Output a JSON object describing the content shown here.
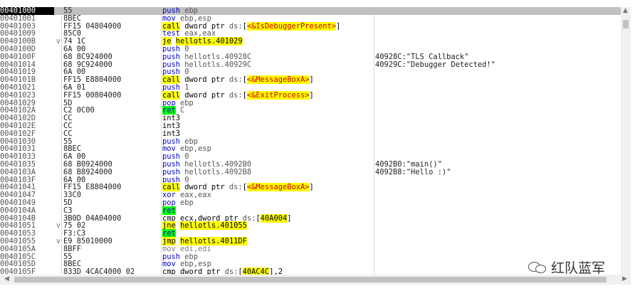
{
  "rows": [
    {
      "addr": "00401000",
      "bytes": "55",
      "mark": "",
      "i": [
        {
          "t": "push ",
          "c": "op"
        },
        {
          "t": "ebp",
          "c": "reg"
        }
      ],
      "cmt": "",
      "sel": true
    },
    {
      "addr": "00401001",
      "bytes": "8BEC",
      "mark": "",
      "i": [
        {
          "t": "mov ",
          "c": "op"
        },
        {
          "t": "ebp,esp",
          "c": "reg"
        }
      ],
      "cmt": ""
    },
    {
      "addr": "00401003",
      "bytes": "FF15 04804000",
      "mark": "",
      "i": [
        {
          "t": "call",
          "c": "hl-call"
        },
        {
          "t": " dword ptr ",
          "c": "ptr"
        },
        {
          "t": "ds:",
          "c": "reg"
        },
        {
          "t": "[",
          "c": "ptr"
        },
        {
          "t": "<&IsDebuggerPresent>",
          "c": "hl-api"
        },
        {
          "t": "]",
          "c": "ptr"
        }
      ],
      "cmt": ""
    },
    {
      "addr": "00401009",
      "bytes": "85C0",
      "mark": "",
      "i": [
        {
          "t": "test ",
          "c": "op"
        },
        {
          "t": "eax,eax",
          "c": "reg"
        }
      ],
      "cmt": ""
    },
    {
      "addr": "0040100B",
      "bytes": "74 1C",
      "mark": "v",
      "i": [
        {
          "t": "je",
          "c": "hl-op"
        },
        {
          "t": " ",
          "c": "ptr"
        },
        {
          "t": "hellotls.401029",
          "c": "hl-tgt"
        }
      ],
      "cmt": ""
    },
    {
      "addr": "0040100D",
      "bytes": "6A 00",
      "mark": "",
      "i": [
        {
          "t": "push ",
          "c": "op"
        },
        {
          "t": "0",
          "c": "imm"
        }
      ],
      "cmt": ""
    },
    {
      "addr": "0040100F",
      "bytes": "68 8C924000",
      "mark": "",
      "i": [
        {
          "t": "push ",
          "c": "op"
        },
        {
          "t": "hellotls.40928C",
          "c": "reg"
        }
      ],
      "cmt": "40928C:\"TLS Callback\""
    },
    {
      "addr": "00401014",
      "bytes": "68 9C924000",
      "mark": "",
      "i": [
        {
          "t": "push ",
          "c": "op"
        },
        {
          "t": "hellotls.40929C",
          "c": "reg"
        }
      ],
      "cmt": "40929C:\"Debugger Detected!\""
    },
    {
      "addr": "00401019",
      "bytes": "6A 00",
      "mark": "",
      "i": [
        {
          "t": "push ",
          "c": "op"
        },
        {
          "t": "0",
          "c": "imm"
        }
      ],
      "cmt": ""
    },
    {
      "addr": "0040101B",
      "bytes": "FF15 E8804000",
      "mark": "",
      "i": [
        {
          "t": "call",
          "c": "hl-call"
        },
        {
          "t": " dword ptr ",
          "c": "ptr"
        },
        {
          "t": "ds:",
          "c": "reg"
        },
        {
          "t": "[",
          "c": "ptr"
        },
        {
          "t": "<&MessageBoxA>",
          "c": "hl-api"
        },
        {
          "t": "]",
          "c": "ptr"
        }
      ],
      "cmt": ""
    },
    {
      "addr": "00401021",
      "bytes": "6A 01",
      "mark": "",
      "i": [
        {
          "t": "push ",
          "c": "op"
        },
        {
          "t": "1",
          "c": "imm"
        }
      ],
      "cmt": ""
    },
    {
      "addr": "00401023",
      "bytes": "FF15 00804000",
      "mark": "",
      "i": [
        {
          "t": "call",
          "c": "hl-call"
        },
        {
          "t": " dword ptr ",
          "c": "ptr"
        },
        {
          "t": "ds:",
          "c": "reg"
        },
        {
          "t": "[",
          "c": "ptr"
        },
        {
          "t": "<&ExitProcess>",
          "c": "hl-api"
        },
        {
          "t": "]",
          "c": "ptr"
        }
      ],
      "cmt": ""
    },
    {
      "addr": "00401029",
      "bytes": "5D",
      "mark": "",
      "i": [
        {
          "t": "pop ",
          "c": "op"
        },
        {
          "t": "ebp",
          "c": "reg"
        }
      ],
      "cmt": ""
    },
    {
      "addr": "0040102A",
      "bytes": "C2 0C00",
      "mark": "",
      "i": [
        {
          "t": "ret",
          "c": "ret-op"
        },
        {
          "t": " C",
          "c": "imm"
        }
      ],
      "cmt": ""
    },
    {
      "addr": "0040102D",
      "bytes": "CC",
      "mark": "",
      "i": [
        {
          "t": "int3",
          "c": "ptr"
        }
      ],
      "cmt": ""
    },
    {
      "addr": "0040102E",
      "bytes": "CC",
      "mark": "",
      "i": [
        {
          "t": "int3",
          "c": "ptr"
        }
      ],
      "cmt": ""
    },
    {
      "addr": "0040102F",
      "bytes": "CC",
      "mark": "",
      "i": [
        {
          "t": "int3",
          "c": "ptr"
        }
      ],
      "cmt": ""
    },
    {
      "addr": "00401030",
      "bytes": "55",
      "mark": "",
      "i": [
        {
          "t": "push ",
          "c": "op"
        },
        {
          "t": "ebp",
          "c": "reg"
        }
      ],
      "cmt": ""
    },
    {
      "addr": "00401031",
      "bytes": "8BEC",
      "mark": "",
      "i": [
        {
          "t": "mov ",
          "c": "op"
        },
        {
          "t": "ebp,esp",
          "c": "reg"
        }
      ],
      "cmt": ""
    },
    {
      "addr": "00401033",
      "bytes": "6A 00",
      "mark": "",
      "i": [
        {
          "t": "push ",
          "c": "op"
        },
        {
          "t": "0",
          "c": "imm"
        }
      ],
      "cmt": ""
    },
    {
      "addr": "00401035",
      "bytes": "68 B0924000",
      "mark": "",
      "i": [
        {
          "t": "push ",
          "c": "op"
        },
        {
          "t": "hellotls.4092B0",
          "c": "reg"
        }
      ],
      "cmt": "4092B0:\"main()\""
    },
    {
      "addr": "0040103A",
      "bytes": "68 B8924000",
      "mark": "",
      "i": [
        {
          "t": "push ",
          "c": "op"
        },
        {
          "t": "hellotls.4092B8",
          "c": "reg"
        }
      ],
      "cmt": "4092B8:\"Hello :)\""
    },
    {
      "addr": "0040103F",
      "bytes": "6A 00",
      "mark": "",
      "i": [
        {
          "t": "push ",
          "c": "op"
        },
        {
          "t": "0",
          "c": "imm"
        }
      ],
      "cmt": ""
    },
    {
      "addr": "00401041",
      "bytes": "FF15 E8804000",
      "mark": "",
      "i": [
        {
          "t": "call",
          "c": "hl-call"
        },
        {
          "t": " dword ptr ",
          "c": "ptr"
        },
        {
          "t": "ds:",
          "c": "reg"
        },
        {
          "t": "[",
          "c": "ptr"
        },
        {
          "t": "<&MessageBoxA>",
          "c": "hl-api"
        },
        {
          "t": "]",
          "c": "ptr"
        }
      ],
      "cmt": ""
    },
    {
      "addr": "00401047",
      "bytes": "33C0",
      "mark": "",
      "i": [
        {
          "t": "xor ",
          "c": "op"
        },
        {
          "t": "eax,eax",
          "c": "reg"
        }
      ],
      "cmt": ""
    },
    {
      "addr": "00401049",
      "bytes": "5D",
      "mark": "",
      "i": [
        {
          "t": "pop ",
          "c": "op"
        },
        {
          "t": "ebp",
          "c": "reg"
        }
      ],
      "cmt": ""
    },
    {
      "addr": "0040104A",
      "bytes": "C3",
      "mark": "",
      "i": [
        {
          "t": "ret",
          "c": "ret-op"
        }
      ],
      "cmt": ""
    },
    {
      "addr": "0040104B",
      "bytes": "3B0D 04A04000",
      "mark": "",
      "i": [
        {
          "t": "cmp ",
          "c": "ptr"
        },
        {
          "t": "ecx,dword ptr ",
          "c": "ptr"
        },
        {
          "t": "ds:",
          "c": "reg"
        },
        {
          "t": "[",
          "c": "ptr"
        },
        {
          "t": "40A004",
          "c": "hl-tgt"
        },
        {
          "t": "]",
          "c": "ptr"
        }
      ],
      "cmt": ""
    },
    {
      "addr": "00401051",
      "bytes": "75 02",
      "mark": "v",
      "i": [
        {
          "t": "jne",
          "c": "hl-op"
        },
        {
          "t": " ",
          "c": "ptr"
        },
        {
          "t": "hellotls.401055",
          "c": "hl-tgt"
        }
      ],
      "cmt": ""
    },
    {
      "addr": "00401053",
      "bytes": "F3:C3",
      "mark": "",
      "i": [
        {
          "t": "ret",
          "c": "ret-op"
        }
      ],
      "cmt": ""
    },
    {
      "addr": "00401055",
      "bytes": "E9 85010000",
      "mark": "v",
      "i": [
        {
          "t": "jmp",
          "c": "hl-op"
        },
        {
          "t": " ",
          "c": "ptr"
        },
        {
          "t": "hellotls.4011DF",
          "c": "hl-tgt"
        }
      ],
      "cmt": ""
    },
    {
      "addr": "0040105A",
      "bytes": "8BFF",
      "mark": "",
      "i": [
        {
          "t": "mov edi,edi",
          "c": "dim"
        }
      ],
      "cmt": ""
    },
    {
      "addr": "0040105C",
      "bytes": "55",
      "mark": "",
      "i": [
        {
          "t": "push ",
          "c": "op"
        },
        {
          "t": "ebp",
          "c": "reg"
        }
      ],
      "cmt": ""
    },
    {
      "addr": "0040105D",
      "bytes": "8BEC",
      "mark": "",
      "i": [
        {
          "t": "mov ",
          "c": "op"
        },
        {
          "t": "ebp,esp",
          "c": "reg"
        }
      ],
      "cmt": ""
    },
    {
      "addr": "0040105F",
      "bytes": "833D 4CAC4000 02",
      "mark": "",
      "i": [
        {
          "t": "cmp ",
          "c": "ptr"
        },
        {
          "t": "dword ptr ",
          "c": "ptr"
        },
        {
          "t": "ds:",
          "c": "reg"
        },
        {
          "t": "[",
          "c": "ptr"
        },
        {
          "t": "40AC4C",
          "c": "hl-tgt"
        },
        {
          "t": "],2",
          "c": "ptr"
        }
      ],
      "cmt": ""
    }
  ],
  "watermark": {
    "text": "红队蓝军",
    "icon": "wechat-icon"
  },
  "colors": {
    "selection": "#c0c0c0",
    "call_highlight": "#ffff00",
    "api_text": "#cc0000",
    "ret_highlight": "#00ff00",
    "mnemonic": "#0000cc"
  }
}
